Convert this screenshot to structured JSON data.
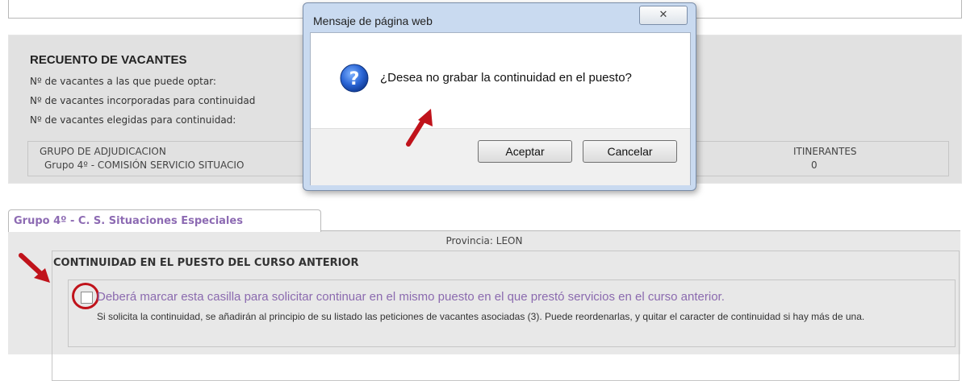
{
  "recuento": {
    "title": "RECUENTO DE VACANTES",
    "lines": [
      "Nº de vacantes a las que puede optar:",
      "Nº de vacantes incorporadas para continuidad",
      "Nº de vacantes elegidas para continuidad:"
    ],
    "table": {
      "headers": [
        "GRUPO DE ADJUDICACION",
        "ITINERANTES"
      ],
      "row": [
        "Grupo 4º - COMISIÓN SERVICIO SITUACIO",
        "0"
      ]
    }
  },
  "tab": {
    "label": "Grupo 4º - C. S. Situaciones Especiales"
  },
  "section": {
    "provincia": "Provincia: LEON",
    "title": "CONTINUIDAD EN EL PUESTO DEL CURSO ANTERIOR",
    "checkbox_label": "Deberá marcar esta casilla para solicitar continuar en el mismo puesto en el que prestó servicios en el curso anterior.",
    "note": "Si solicita la continuidad, se añadirán al principio de su listado las peticiones de vacantes asociadas (3). Puede reordenarlas, y quitar el caracter de continuidad si hay más de una.",
    "checkbox_checked": false
  },
  "dialog": {
    "title": "Mensaje de página web",
    "close_glyph": "✕",
    "message": "¿Desea no grabar la continuidad en el puesto?",
    "icon": "question-icon",
    "accept_label": "Aceptar",
    "cancel_label": "Cancelar"
  },
  "colors": {
    "annotation_red": "#c0131b",
    "tab_text": "#8d6bb3",
    "checkbox_text": "#8b6aaf"
  }
}
